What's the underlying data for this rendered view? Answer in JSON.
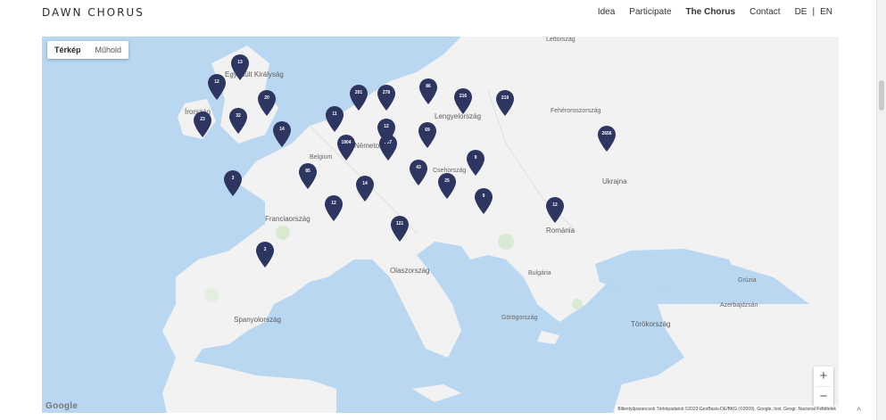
{
  "header": {
    "logo": "DAWN CHORUS",
    "nav": [
      "Idea",
      "Participate",
      "The Chorus",
      "Contact"
    ],
    "active": "The Chorus",
    "lang": [
      "DE",
      "|",
      "EN"
    ]
  },
  "map": {
    "map_type": [
      "Térkép",
      "Műhold"
    ],
    "zoom_in": "+",
    "zoom_out": "−",
    "google": "Google",
    "attribution": "Billentyűparancsok   Térképadatok ©2023 GeoBasis-DE/BKG (©2009), Google, Inst. Geogr. Nacional   Feltételek",
    "labels": [
      {
        "text": "Egyesült Királyság",
        "big": true
      },
      {
        "text": "Írország",
        "big": true
      },
      {
        "text": "Németország",
        "big": true
      },
      {
        "text": "Lengyelország",
        "big": true
      },
      {
        "text": "Ukrajna",
        "big": true
      },
      {
        "text": "Franciaország",
        "big": true
      },
      {
        "text": "Olaszország",
        "big": true
      },
      {
        "text": "Spanyolország",
        "big": true
      },
      {
        "text": "Románia",
        "big": true
      },
      {
        "text": "Törökország",
        "big": true
      },
      {
        "text": "Fehéroroszország",
        "big": false
      },
      {
        "text": "Lettország",
        "big": false
      },
      {
        "text": "Bulgária",
        "big": false
      },
      {
        "text": "Görögország",
        "big": false
      },
      {
        "text": "Azerbajdzsán",
        "big": false
      },
      {
        "text": "Grúzia",
        "big": false
      },
      {
        "text": "Belgium",
        "big": false
      },
      {
        "text": "Csehország",
        "big": false
      }
    ],
    "pins": [
      "13",
      "12",
      "20",
      "32",
      "23",
      "14",
      "11",
      "201",
      "278",
      "86",
      "216",
      "219",
      "2656",
      "227",
      "1904",
      "12",
      "69",
      "43",
      "85",
      "14",
      "12",
      "3",
      "121",
      "9",
      "25",
      "9",
      "12",
      "3"
    ]
  }
}
